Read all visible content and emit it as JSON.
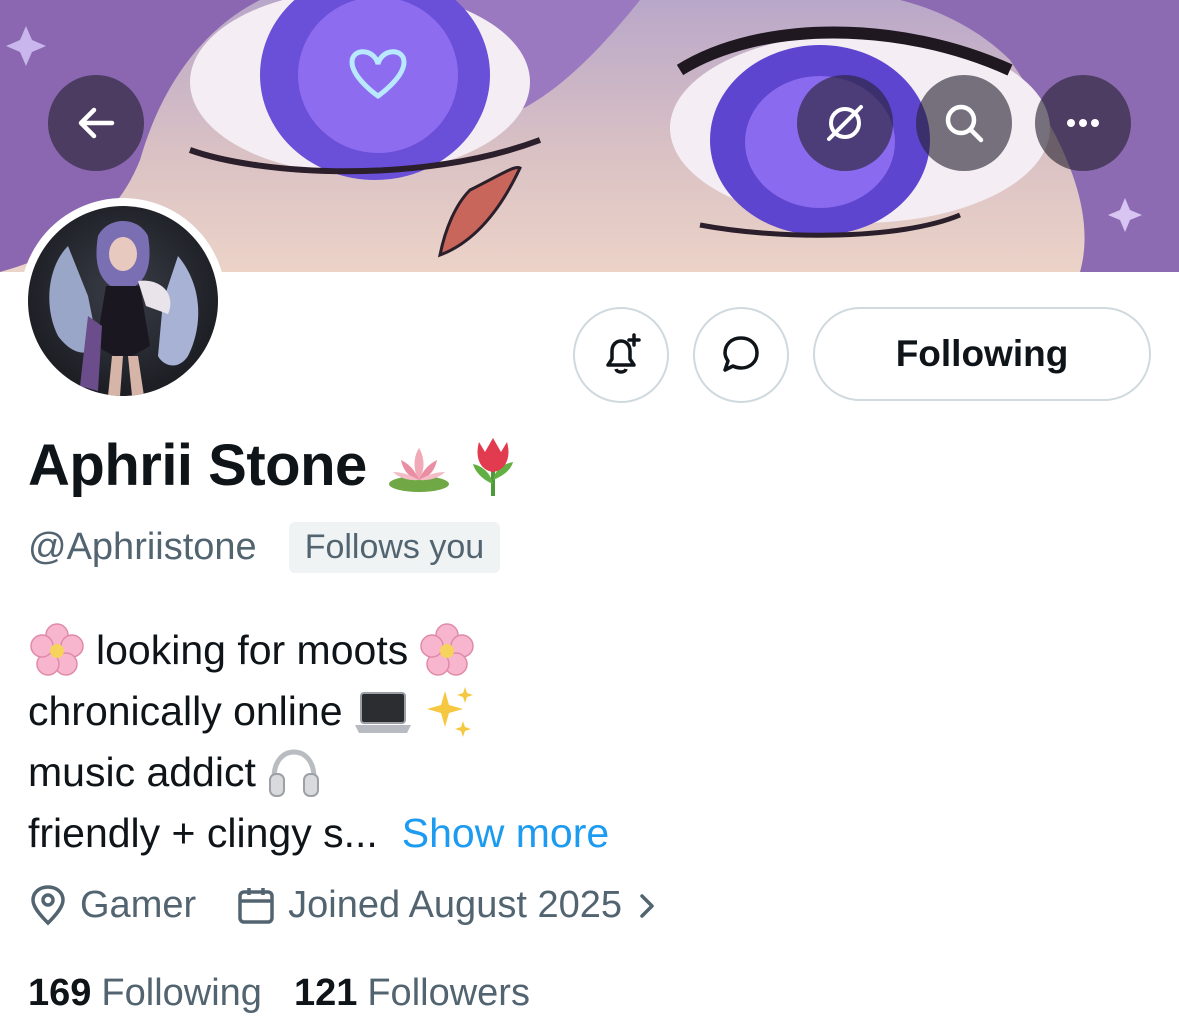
{
  "header": {
    "back_icon": "arrow-left-icon",
    "grok_icon": "grok-icon",
    "search_icon": "search-icon",
    "more_icon": "more-horizontal-icon"
  },
  "profile": {
    "display_name": "Aphrii Stone",
    "name_emojis": [
      "lotus-emoji",
      "tulip-emoji"
    ],
    "handle": "@Aphriistone",
    "follows_you": "Follows you"
  },
  "actions": {
    "notify_icon": "bell-plus-icon",
    "message_icon": "message-bubble-icon",
    "following_label": "Following"
  },
  "bio": {
    "line1": "looking for moots",
    "line2": "chronically online",
    "line3": "music addict",
    "line4": "friendly + clingy s...",
    "show_more": "Show more"
  },
  "meta": {
    "location": "Gamer",
    "joined": "Joined August 2025"
  },
  "stats": {
    "following_count": "169",
    "following_label": "Following",
    "followers_count": "121",
    "followers_label": "Followers"
  },
  "colors": {
    "text_primary": "#0f1419",
    "text_secondary": "#536471",
    "link": "#1d9bf0",
    "border": "#cfd9de",
    "badge_bg": "#eff3f4"
  }
}
